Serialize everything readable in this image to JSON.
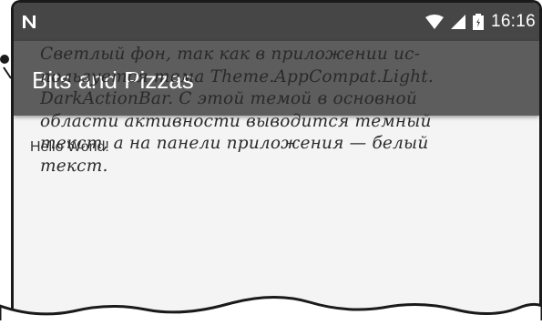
{
  "status_bar": {
    "time": "16:16",
    "icons": [
      "notification-n-icon",
      "wifi-icon",
      "cell-signal-icon",
      "battery-icon"
    ]
  },
  "app_bar": {
    "title": "Bits and Pizzas"
  },
  "content": {
    "hello_text": "Hello World!"
  },
  "annotation": {
    "lines": [
      "Светлый фон, так как в приложении ис-",
      "пользуется тема Theme.AppCompat.Light.",
      "DarkActionBar. С этой темой в основной",
      "области активности выводится темный",
      "текст, а на панели приложения — белый",
      "текст."
    ]
  },
  "colors": {
    "status_bar": "#464646",
    "app_bar": "#5d5d5d",
    "background": "#f4f4f4"
  }
}
